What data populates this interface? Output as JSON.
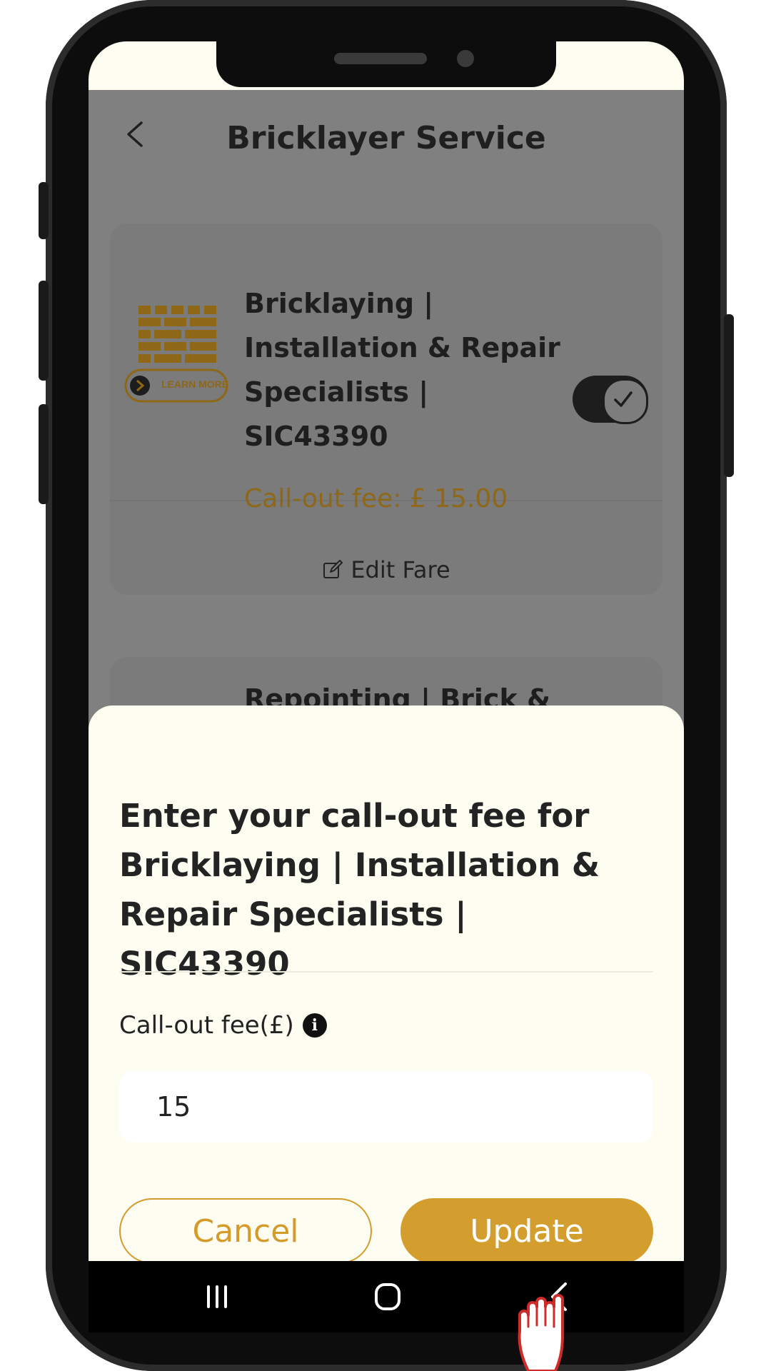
{
  "header": {
    "title": "Bricklayer Service",
    "back_icon": "chevron-left-icon"
  },
  "services": [
    {
      "title": "Bricklaying | Installation & Repair Specialists | SIC43390",
      "fee_text": "Call-out fee: £ 15.00",
      "enabled": true,
      "edit_label": "Edit Fare",
      "logo_caption": "LEARN MORE"
    },
    {
      "title": "Repointing | Brick & Stone Restoration"
    }
  ],
  "sheet": {
    "heading": "Enter your call-out fee for Bricklaying | Installation & Repair Specialists | SIC43390",
    "fee_label": "Call-out fee(£)",
    "fee_value": "15",
    "cancel_label": "Cancel",
    "update_label": "Update"
  },
  "colors": {
    "accent": "#d49e2e",
    "fee_text_dim": "#8e6717",
    "sheet_bg": "#fdfdf2"
  },
  "nav": {
    "items": [
      "recent-apps-icon",
      "home-icon",
      "back-icon"
    ]
  }
}
